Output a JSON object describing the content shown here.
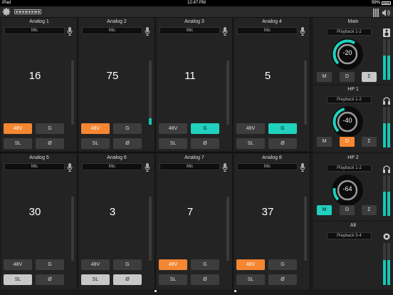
{
  "status": {
    "carrier": "iPad",
    "time": "12:47 PM",
    "battery": "99%"
  },
  "channels": [
    {
      "title": "Analog 1",
      "source": "Mic",
      "value": "16",
      "level": 0.16,
      "meter": 0,
      "b48": "48V",
      "bg": "G",
      "bsl": "SL",
      "bphase": "Ø",
      "on48": true,
      "onG": false,
      "onSL": false,
      "onPh": false
    },
    {
      "title": "Analog 2",
      "source": "Mic",
      "value": "75",
      "level": 0.75,
      "meter": 0.1,
      "b48": "48V",
      "bg": "G",
      "bsl": "SL",
      "bphase": "Ø",
      "on48": true,
      "onG": false,
      "onSL": false,
      "onPh": false
    },
    {
      "title": "Analog 3",
      "source": "Mic",
      "value": "11",
      "level": 0.11,
      "meter": 0,
      "b48": "48V",
      "bg": "G",
      "bsl": "SL",
      "bphase": "Ø",
      "on48": false,
      "onG": true,
      "onSL": false,
      "onPh": false
    },
    {
      "title": "Analog 4",
      "source": "Mic",
      "value": "5",
      "level": 0.05,
      "meter": 0,
      "b48": "48V",
      "bg": "G",
      "bsl": "SL",
      "bphase": "Ø",
      "on48": false,
      "onG": true,
      "onSL": false,
      "onPh": false
    },
    {
      "title": "Analog 5",
      "source": "Mic",
      "value": "30",
      "level": 0.3,
      "meter": 0,
      "b48": "48V",
      "bg": "G",
      "bsl": "SL",
      "bphase": "Ø",
      "on48": false,
      "onG": false,
      "onSL": true,
      "onPh": false
    },
    {
      "title": "Analog 6",
      "source": "Mic",
      "value": "3",
      "level": 0.03,
      "meter": 0,
      "b48": "48V",
      "bg": "G",
      "bsl": "SL",
      "bphase": "Ø",
      "on48": false,
      "onG": false,
      "onSL": true,
      "onPh": true
    },
    {
      "title": "Analog 7",
      "source": "Mic",
      "value": "7",
      "level": 0.07,
      "meter": 0,
      "b48": "48V",
      "bg": "G",
      "bsl": "SL",
      "bphase": "Ø",
      "on48": true,
      "onG": false,
      "onSL": false,
      "onPh": false
    },
    {
      "title": "Analog 8",
      "source": "Mic",
      "value": "37",
      "level": 0.37,
      "meter": 0,
      "b48": "48V",
      "bg": "G",
      "bsl": "SL",
      "bphase": "Ø",
      "on48": true,
      "onG": false,
      "onSL": false,
      "onPh": false
    }
  ],
  "outputs": [
    {
      "title": "Main",
      "source": "Playback 1-2",
      "value": "-20",
      "level": 0.62,
      "icon": "speaker-icon",
      "m": "M",
      "d": "D",
      "s": "Σ",
      "onM": false,
      "onD": false,
      "onS": true,
      "meterL": 0.6,
      "meterR": 0.6
    },
    {
      "title": "HP 1",
      "source": "Playback 1-2",
      "value": "-40",
      "level": 0.45,
      "icon": "headphones-icon",
      "m": "M",
      "d": "D",
      "s": "Σ",
      "onM": false,
      "onD": true,
      "onS": false,
      "meterL": 0.6,
      "meterR": 0.6
    },
    {
      "title": "HP 2",
      "source": "Playback 1-2",
      "value": "-64",
      "level": 0.2,
      "icon": "headphones-icon",
      "m": "M",
      "d": "D",
      "s": "Σ",
      "onM": true,
      "onD": false,
      "onS": false,
      "meterL": 0.6,
      "meterR": 0.6
    },
    {
      "title": "Alt",
      "source": "Playback 3-4",
      "icon": "speaker-alt-icon",
      "meterL": 0.6,
      "meterR": 0.6
    }
  ],
  "colors": {
    "accent": "#20d1bf",
    "active": "#f58632",
    "ring": "#9a9a9a",
    "track": "#0b0b0b"
  }
}
